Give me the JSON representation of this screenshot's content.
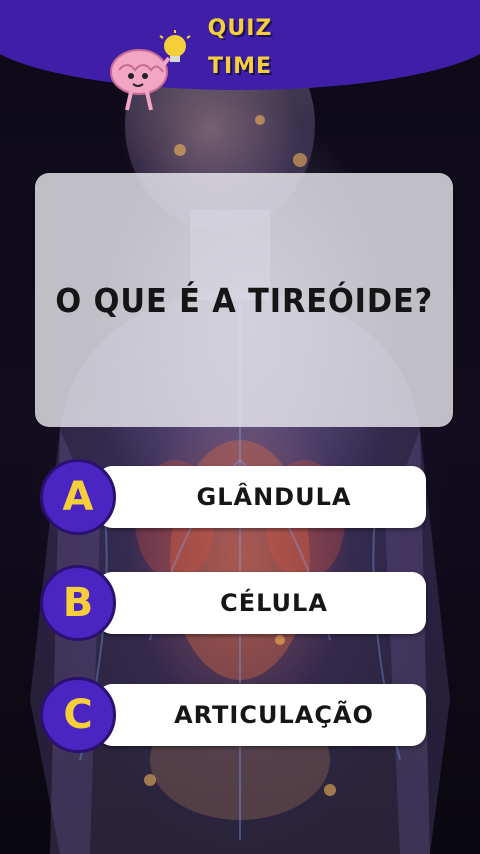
{
  "header": {
    "title_line1": "QUIZ",
    "title_line2": "TIME",
    "mascot_icon": "brain-lightbulb-icon",
    "accent_color": "#3f1fa8",
    "title_color": "#f5cf3a"
  },
  "question": {
    "text": "O QUE É A TIREÓIDE?"
  },
  "options": [
    {
      "letter": "A",
      "label": "GLÂNDULA"
    },
    {
      "letter": "B",
      "label": "CÉLULA"
    },
    {
      "letter": "C",
      "label": "ARTICULAÇÃO"
    }
  ],
  "background": {
    "image": "human-anatomy-illustration"
  }
}
